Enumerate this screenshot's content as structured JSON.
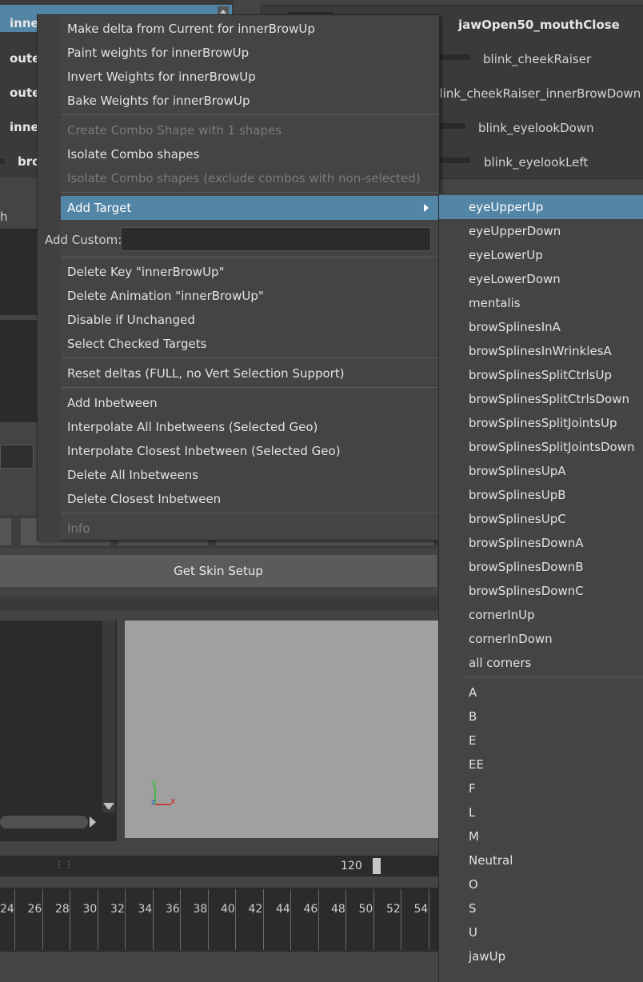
{
  "background": {
    "left_list": [
      {
        "label": "inne",
        "selected": true
      },
      {
        "label": "oute",
        "selected": false
      },
      {
        "label": "oute",
        "selected": false
      },
      {
        "label": "inne",
        "selected": false
      },
      {
        "label": "bro",
        "selected": false
      }
    ],
    "left_fragment": "h",
    "right_list": [
      {
        "label": "jawOpen50_mouthClose",
        "bold": true
      },
      {
        "label": "blink_cheekRaiser",
        "bold": false
      },
      {
        "label": "blink_cheekRaiser_innerBrowDown",
        "bold": false
      },
      {
        "label": "blink_eyelookDown",
        "bold": false
      },
      {
        "label": "blink_eyelookLeft",
        "bold": false
      }
    ],
    "skin_button": "Get Skin Setup",
    "frame_end_value": "120",
    "timeline_ticks": [
      "24",
      "26",
      "28",
      "30",
      "32",
      "34",
      "36",
      "38",
      "40",
      "42",
      "44",
      "46",
      "48",
      "50",
      "52",
      "54"
    ]
  },
  "context_menu": {
    "items_group1": [
      {
        "label": "Make delta from Current for innerBrowUp",
        "enabled": true
      },
      {
        "label": "Paint weights for innerBrowUp",
        "enabled": true
      },
      {
        "label": "Invert Weights for innerBrowUp",
        "enabled": true
      },
      {
        "label": "Bake Weights for innerBrowUp",
        "enabled": true
      }
    ],
    "items_group2": [
      {
        "label": "Create Combo Shape with 1 shapes",
        "enabled": false
      },
      {
        "label": "Isolate Combo shapes",
        "enabled": true
      },
      {
        "label": "Isolate Combo shapes (exclude combos with non-selected)",
        "enabled": false
      }
    ],
    "add_target": "Add Target",
    "add_custom_label": "Add Custom:",
    "add_custom_value": "",
    "items_group3": [
      {
        "label": "Delete Key \"innerBrowUp\"",
        "enabled": true
      },
      {
        "label": "Delete Animation \"innerBrowUp\"",
        "enabled": true
      },
      {
        "label": "Disable if Unchanged",
        "enabled": true
      },
      {
        "label": "Select Checked Targets",
        "enabled": true
      }
    ],
    "reset_deltas": "Reset deltas (FULL, no Vert Selection Support)",
    "items_group4": [
      {
        "label": "Add Inbetween",
        "enabled": true
      },
      {
        "label": "Interpolate All Inbetweens (Selected Geo)",
        "enabled": true
      },
      {
        "label": "Interpolate Closest Inbetween (Selected Geo)",
        "enabled": true
      },
      {
        "label": "Delete All Inbetweens",
        "enabled": true
      },
      {
        "label": "Delete Closest Inbetween",
        "enabled": true
      }
    ],
    "info": "Info"
  },
  "submenu": {
    "targets": [
      "eyeUpperUp",
      "eyeUpperDown",
      "eyeLowerUp",
      "eyeLowerDown",
      "mentalis",
      "browSplinesInA",
      "browSplinesInWrinklesA",
      "browSplinesSplitCtrlsUp",
      "browSplinesSplitCtrlsDown",
      "browSplinesSplitJointsUp",
      "browSplinesSplitJointsDown",
      "browSplinesUpA",
      "browSplinesUpB",
      "browSplinesUpC",
      "browSplinesDownA",
      "browSplinesDownB",
      "browSplinesDownC",
      "cornerInUp",
      "cornerInDown",
      "all corners"
    ],
    "visemes": [
      "A",
      "B",
      "E",
      "EE",
      "F",
      "L",
      "M",
      "Neutral",
      "O",
      "S",
      "U",
      "jawUp"
    ]
  },
  "colors": {
    "highlight": "#5285a6",
    "menu_bg": "#444444",
    "viewport": "#a0a0a0"
  }
}
